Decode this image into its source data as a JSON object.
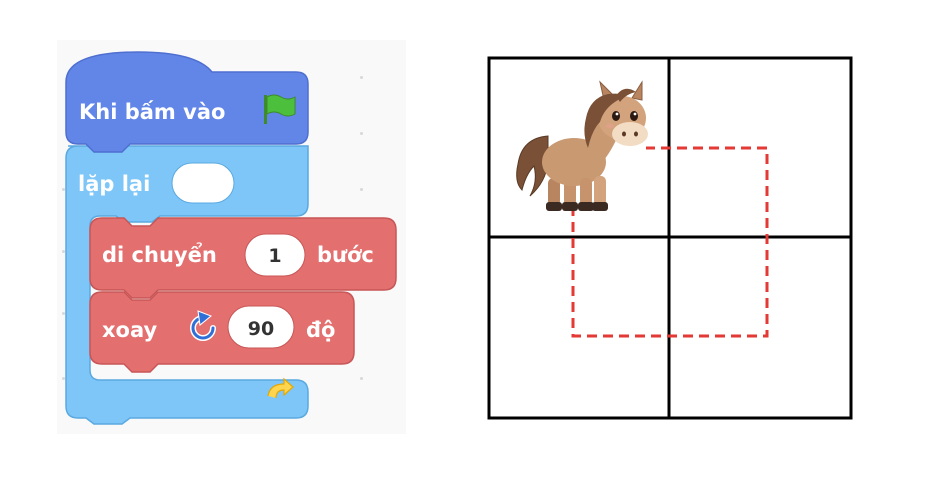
{
  "blocks": {
    "hat": {
      "label": "Khi bấm vào",
      "flag_icon": "green-flag-icon",
      "color": "#5b80e0"
    },
    "repeat": {
      "label": "lặp lại",
      "count": "",
      "color": "#6cbdf5",
      "loop_icon": "loop-arrow-icon"
    },
    "move": {
      "label": "di chuyển",
      "steps": "1",
      "unit": "bước",
      "color": "#e06a6a"
    },
    "turn": {
      "label": "xoay",
      "icon": "rotate-right-icon",
      "degrees": "90",
      "unit": "độ",
      "color": "#e06a6a"
    }
  },
  "stage": {
    "grid": {
      "rows": 2,
      "cols": 2
    },
    "sprite": "horse",
    "path_color": "#e53935"
  }
}
